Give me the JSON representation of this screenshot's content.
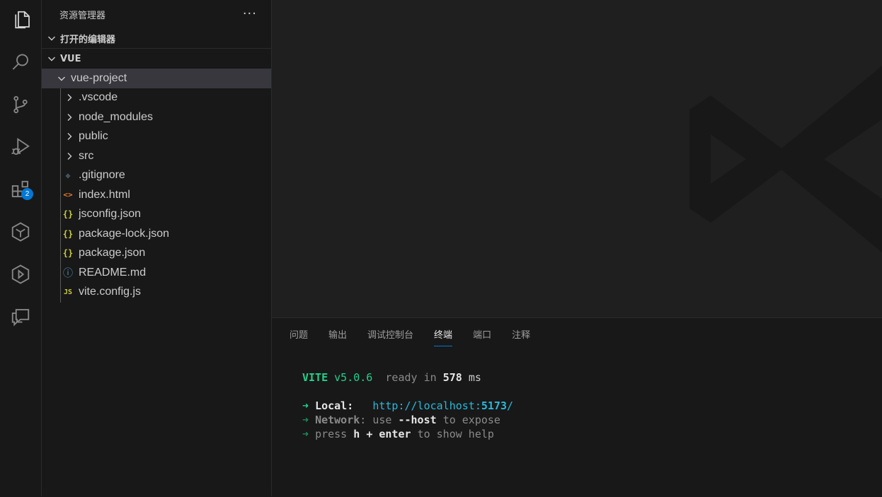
{
  "colors": {
    "accent": "#0078d4",
    "vite_green": "#23d18b",
    "link_cyan": "#29b8db",
    "badge_bg": "#0078d4"
  },
  "activity_bar": {
    "items": [
      {
        "name": "explorer-icon",
        "active": true
      },
      {
        "name": "search-icon"
      },
      {
        "name": "source-control-icon"
      },
      {
        "name": "run-debug-icon"
      },
      {
        "name": "extensions-icon",
        "badge": "2"
      },
      {
        "name": "ai-assistant-icon"
      },
      {
        "name": "remote-icon"
      },
      {
        "name": "chat-icon"
      }
    ]
  },
  "sidebar": {
    "title": "资源管理器",
    "more": "···",
    "open_editors": "打开的编辑器",
    "workspace": "VUE",
    "project": "vue-project",
    "folders": [
      ".vscode",
      "node_modules",
      "public",
      "src"
    ],
    "files": [
      {
        "label": ".gitignore",
        "icon": "git-icon",
        "glyph": "◆",
        "color": "#41535b"
      },
      {
        "label": "index.html",
        "icon": "html-icon",
        "glyph": "<>",
        "color": "#e37933"
      },
      {
        "label": "jsconfig.json",
        "icon": "json-icon",
        "glyph": "{}",
        "color": "#cbcb41"
      },
      {
        "label": "package-lock.json",
        "icon": "json-icon",
        "glyph": "{}",
        "color": "#cbcb41"
      },
      {
        "label": "package.json",
        "icon": "json-icon",
        "glyph": "{}",
        "color": "#cbcb41"
      },
      {
        "label": "README.md",
        "icon": "info-icon",
        "glyph": "ⓘ",
        "color": "#519aba"
      },
      {
        "label": "vite.config.js",
        "icon": "js-icon",
        "glyph": "JS",
        "color": "#cbcb41"
      }
    ]
  },
  "panel": {
    "tabs": [
      "问题",
      "输出",
      "调试控制台",
      "终端",
      "端口",
      "注释"
    ],
    "active_tab": "终端"
  },
  "terminal": {
    "vite": "VITE",
    "version": "v5.0.6",
    "ready": "ready in",
    "ms_value": "578",
    "ms_unit": "ms",
    "arrow": "➜",
    "local_label": "Local",
    "local_url_prefix": "http://localhost:",
    "local_port": "5173",
    "local_url_suffix": "/",
    "network_label": "Network",
    "network_text_1": "use",
    "network_flag": "--host",
    "network_text_2": "to expose",
    "press": "press",
    "key_h": "h",
    "plus": "+",
    "key_enter": "enter",
    "help_text": "to show help"
  }
}
